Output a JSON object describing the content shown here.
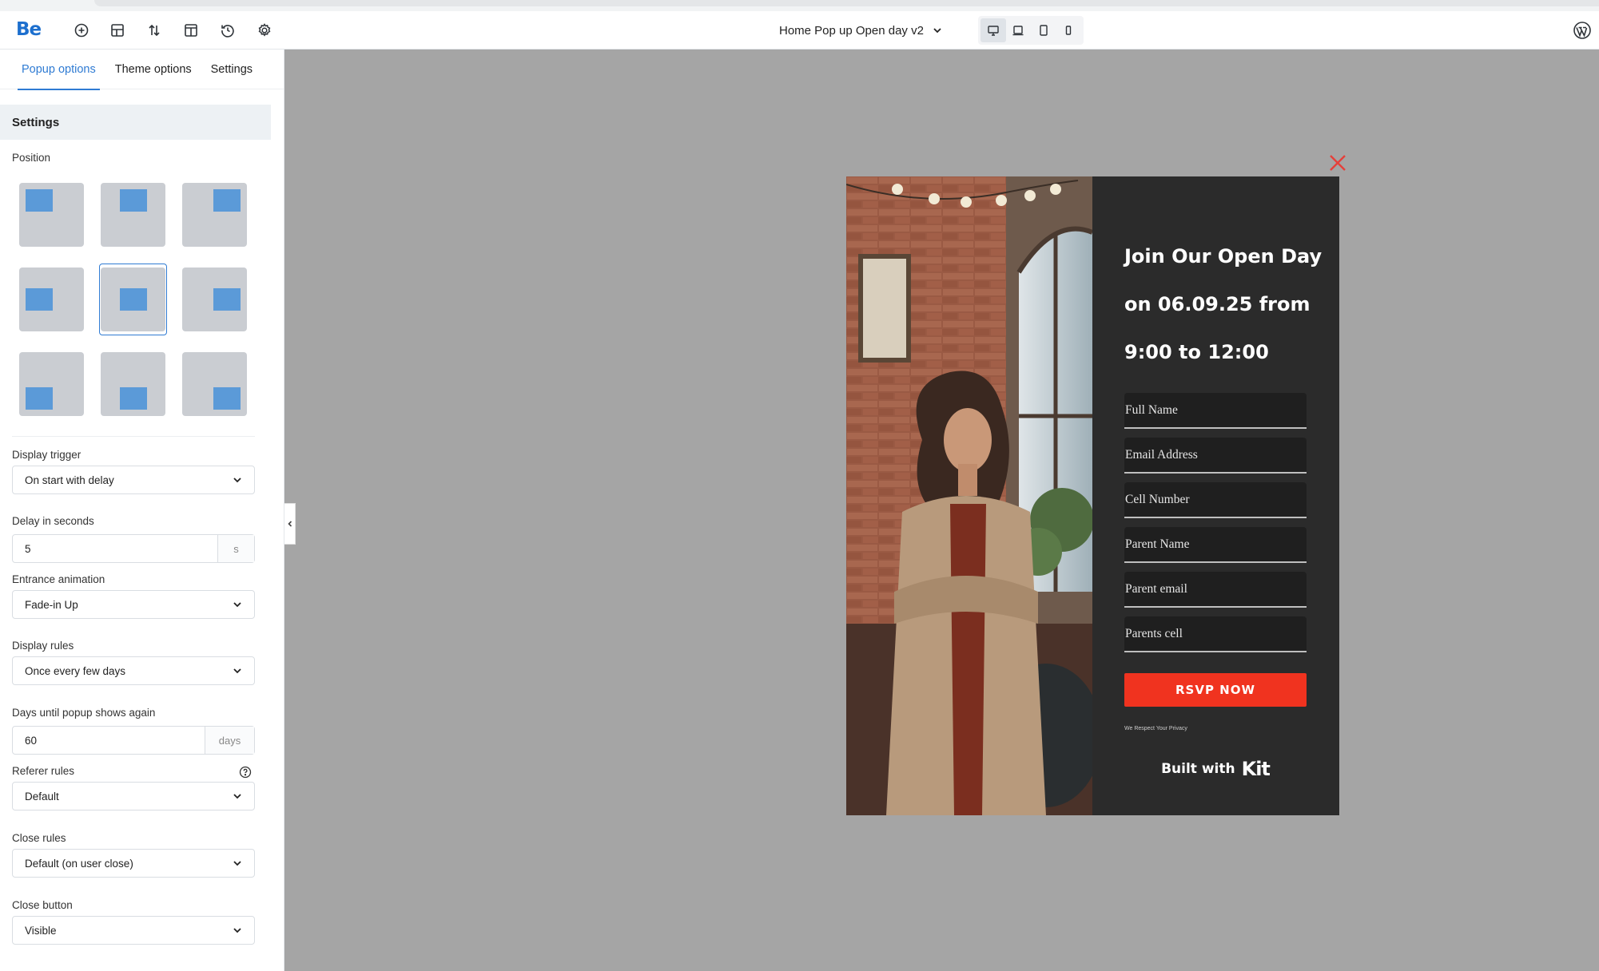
{
  "topbar": {
    "logo": "Be",
    "page_name": "Home Pop up Open day v2"
  },
  "sidebar": {
    "tabs": [
      {
        "label": "Popup options"
      },
      {
        "label": "Theme options"
      },
      {
        "label": "Settings"
      }
    ],
    "section_title": "Settings",
    "position_label": "Position",
    "selected_position": "center",
    "fields": {
      "display_trigger": {
        "label": "Display trigger",
        "value": "On start with delay"
      },
      "delay": {
        "label": "Delay in seconds",
        "value": "5",
        "unit": "s"
      },
      "entrance_animation": {
        "label": "Entrance animation",
        "value": "Fade-in Up"
      },
      "display_rules": {
        "label": "Display rules",
        "value": "Once every few days"
      },
      "days_until": {
        "label": "Days until popup shows again",
        "value": "60",
        "unit": "days"
      },
      "referer_rules": {
        "label": "Referer rules",
        "value": "Default"
      },
      "close_rules": {
        "label": "Close rules",
        "value": "Default (on user close)"
      },
      "close_button": {
        "label": "Close button",
        "value": "Visible"
      }
    }
  },
  "popup": {
    "title_lines": [
      "Join Our Open Day",
      "on 06.09.25 from",
      "9:00 to 12:00"
    ],
    "fields": [
      "Full Name",
      "Email Address",
      "Cell Number",
      "Parent Name",
      "Parent email",
      "Parents cell"
    ],
    "button": "RSVP NOW",
    "privacy": "We Respect Your Privacy",
    "built_with": "Built with",
    "kit_logo": "Kit"
  },
  "colors": {
    "accent": "#2f7bd3",
    "popup_bg": "#2b2b2b",
    "rsvp": "#f0331f",
    "close_x": "#e5403b",
    "canvas": "#a5a5a5"
  }
}
